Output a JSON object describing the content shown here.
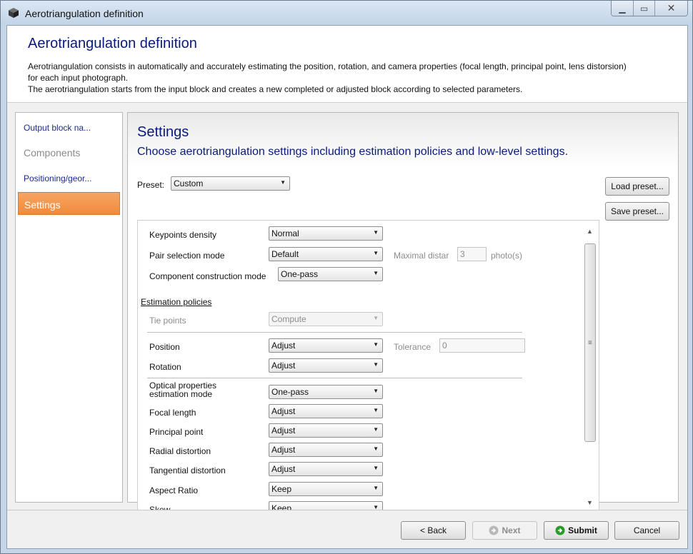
{
  "window": {
    "title": "Aerotriangulation definition",
    "controls": [
      "▭",
      "⧉",
      "✕"
    ]
  },
  "header": {
    "title": "Aerotriangulation definition",
    "line1": "Aerotriangulation consists in automatically and accurately estimating the position, rotation, and camera properties (focal length, principal point, lens distorsion)",
    "line2": "for each input photograph.",
    "line3": "The aerotriangulation starts from the input block and creates a new completed or adjusted block according to selected parameters."
  },
  "nav": {
    "items": [
      {
        "label": "Output block na..."
      },
      {
        "label": "Components"
      },
      {
        "label": "Positioning/geor..."
      },
      {
        "label": "Settings"
      }
    ]
  },
  "panel": {
    "title": "Settings",
    "subtitle": "Choose aerotriangulation settings including estimation policies and low-level settings.",
    "preset_label": "Preset:",
    "preset_value": "Custom",
    "load_preset": "Load preset...",
    "save_preset": "Save preset..."
  },
  "settings": {
    "keypoints_density": {
      "label": "Keypoints density",
      "value": "Normal"
    },
    "pair_selection": {
      "label": "Pair selection mode",
      "value": "Default",
      "extra_label": "Maximal distar",
      "extra_value": "3",
      "extra_unit": "photo(s)"
    },
    "component_construction": {
      "label": "Component construction mode",
      "value": "One-pass"
    },
    "estimation_header": "Estimation policies",
    "tie_points": {
      "label": "Tie points",
      "value": "Compute"
    },
    "position": {
      "label": "Position",
      "value": "Adjust",
      "extra_label": "Tolerance",
      "extra_value": "0"
    },
    "rotation": {
      "label": "Rotation",
      "value": "Adjust"
    },
    "optical": {
      "label_line1": "Optical properties",
      "label_line2": "estimation mode",
      "value": "One-pass"
    },
    "focal_length": {
      "label": "Focal length",
      "value": "Adjust"
    },
    "principal_point": {
      "label": "Principal point",
      "value": "Adjust"
    },
    "radial_distortion": {
      "label": "Radial distortion",
      "value": "Adjust"
    },
    "tangential_distortion": {
      "label": "Tangential distortion",
      "value": "Adjust"
    },
    "aspect_ratio": {
      "label": "Aspect Ratio",
      "value": "Keep"
    },
    "skew": {
      "label": "Skew",
      "value": "Keep"
    }
  },
  "footer": {
    "back": "< Back",
    "next": "Next",
    "submit": "Submit",
    "cancel": "Cancel"
  },
  "colors": {
    "accent_orange": "#f18a3c",
    "title_blue": "#0a1a7a",
    "submit_green": "#2a9a2a"
  }
}
